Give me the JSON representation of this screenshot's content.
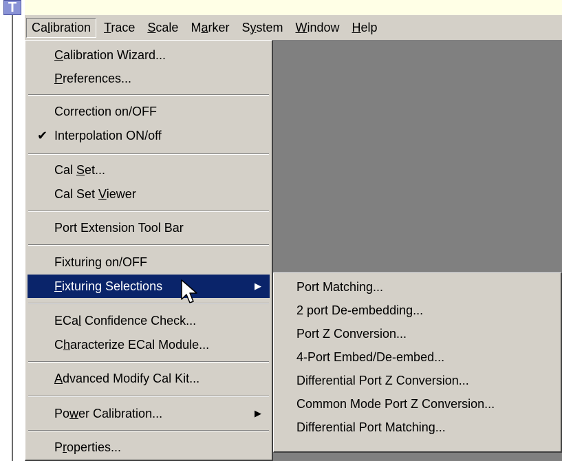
{
  "app_icon_letter": "T",
  "menubar": {
    "items": [
      {
        "pre": "Ca",
        "key": "l",
        "post": "ibration"
      },
      {
        "pre": "",
        "key": "T",
        "post": "race"
      },
      {
        "pre": "",
        "key": "S",
        "post": "cale"
      },
      {
        "pre": "M",
        "key": "a",
        "post": "rker"
      },
      {
        "pre": "S",
        "key": "y",
        "post": "stem"
      },
      {
        "pre": "",
        "key": "W",
        "post": "indow"
      },
      {
        "pre": "",
        "key": "H",
        "post": "elp"
      }
    ]
  },
  "calibration_menu": {
    "items": [
      {
        "pre": "",
        "key": "C",
        "post": "alibration Wizard..."
      },
      {
        "pre": "",
        "key": "P",
        "post": "references..."
      },
      {
        "text": "Correction on/OFF"
      },
      {
        "text": "Interpolation ON/off",
        "checked": true
      },
      {
        "pre": "Cal ",
        "key": "S",
        "post": "et..."
      },
      {
        "pre": "Cal Set ",
        "key": "V",
        "post": "iewer"
      },
      {
        "text": "Port Extension Tool Bar"
      },
      {
        "text": "Fixturing on/OFF"
      },
      {
        "pre": "",
        "key": "F",
        "post": "ixturing Selections"
      },
      {
        "pre": "ECa",
        "key": "l",
        "post": " Confidence Check..."
      },
      {
        "pre": "C",
        "key": "h",
        "post": "aracterize ECal Module..."
      },
      {
        "pre": "",
        "key": "A",
        "post": "dvanced Modify Cal Kit..."
      },
      {
        "pre": "Po",
        "key": "w",
        "post": "er Calibration..."
      },
      {
        "pre": "P",
        "key": "r",
        "post": "operties..."
      }
    ],
    "checkmark": "✔",
    "submenu_arrow": "▶"
  },
  "fixturing_submenu": {
    "items": [
      "Port Matching...",
      "2 port De-embedding...",
      "Port Z Conversion...",
      "4-Port Embed/De-embed...",
      "Differential Port Z Conversion...",
      "Common Mode Port Z Conversion...",
      "Differential Port Matching..."
    ]
  },
  "colors": {
    "menu_bg": "#d4d0c8",
    "highlight": "#0a246a",
    "workspace": "#808080"
  }
}
